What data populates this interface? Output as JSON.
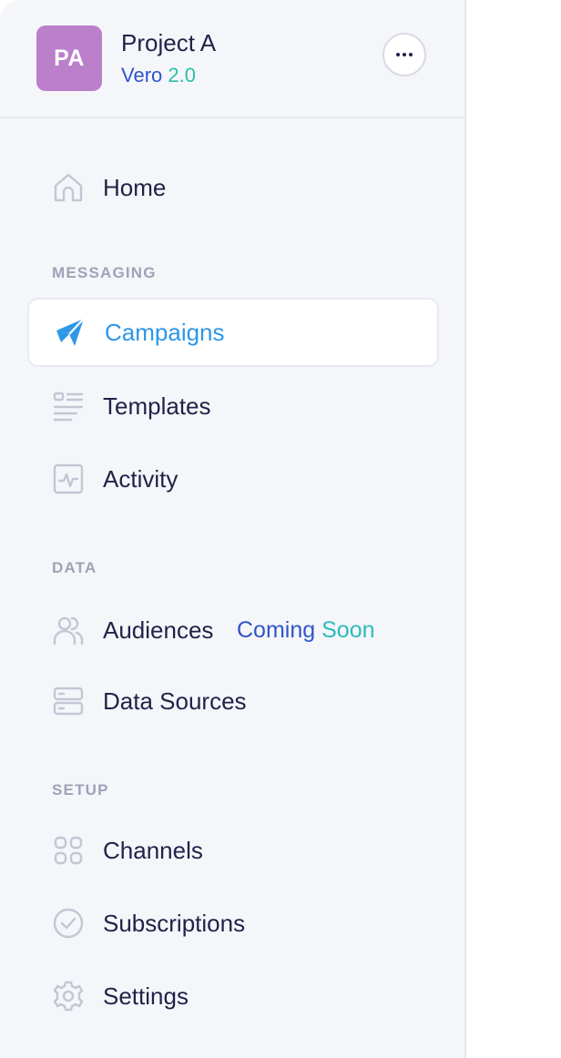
{
  "project": {
    "initials": "PA",
    "name": "Project A",
    "product": "Vero",
    "version": "2.0"
  },
  "colors": {
    "avatar": "#bb7fcc",
    "active": "#2e97e8",
    "text": "#1f2347",
    "muted": "#9ea3b8",
    "sidebar_bg": "#f5f6fa",
    "badge_start": "#2f55c9",
    "badge_end": "#28c2a6"
  },
  "nav": {
    "home": {
      "label": "Home",
      "icon": "home-icon"
    },
    "messaging": {
      "title": "MESSAGING",
      "items": [
        {
          "label": "Campaigns",
          "icon": "paper-plane-icon",
          "active": true
        },
        {
          "label": "Templates",
          "icon": "template-list-icon"
        },
        {
          "label": "Activity",
          "icon": "activity-pulse-icon"
        }
      ]
    },
    "data": {
      "title": "DATA",
      "items": [
        {
          "label": "Audiences",
          "icon": "users-icon",
          "badge_part1": "Coming",
          "badge_part2": "Soon"
        },
        {
          "label": "Data Sources",
          "icon": "server-icon"
        }
      ]
    },
    "setup": {
      "title": "SETUP",
      "items": [
        {
          "label": "Channels",
          "icon": "channels-grid-icon"
        },
        {
          "label": "Subscriptions",
          "icon": "check-circle-icon"
        },
        {
          "label": "Settings",
          "icon": "gear-icon"
        }
      ]
    }
  }
}
